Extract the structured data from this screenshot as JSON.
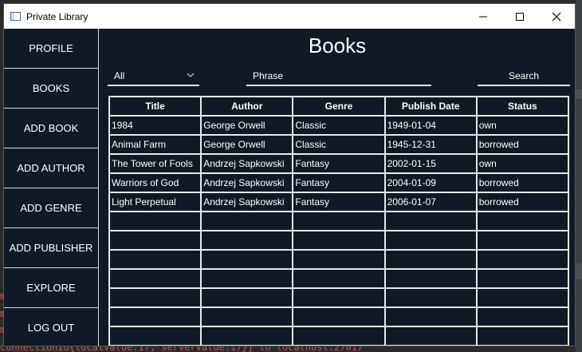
{
  "window": {
    "title": "Private Library"
  },
  "background": {
    "console_line": "connectionId{localValue:17, serverValue:17}] to localhost:27017",
    "console_marks": [
      "m",
      "m",
      "m"
    ]
  },
  "sidebar": {
    "items": [
      {
        "label": "PROFILE"
      },
      {
        "label": "BOOKS"
      },
      {
        "label": "ADD BOOK"
      },
      {
        "label": "ADD AUTHOR"
      },
      {
        "label": "ADD GENRE"
      },
      {
        "label": "ADD PUBLISHER"
      },
      {
        "label": "EXPLORE"
      },
      {
        "label": "LOG OUT"
      }
    ]
  },
  "main": {
    "title": "Books",
    "filter": {
      "selected": "All"
    },
    "search": {
      "placeholder": "Phrase",
      "button_label": "Search"
    },
    "table": {
      "columns": [
        "Title",
        "Author",
        "Genre",
        "Publish Date",
        "Status"
      ],
      "rows": [
        [
          "1984",
          "George Orwell",
          "Classic",
          "1949-01-04",
          "own"
        ],
        [
          "Animal Farm",
          "George Orwell",
          "Classic",
          "1945-12-31",
          "borrowed"
        ],
        [
          "The Tower of Fools",
          "Andrzej Sapkowski",
          "Fantasy",
          "2002-01-15",
          "own"
        ],
        [
          "Warriors of God",
          "Andrzej Sapkowski",
          "Fantasy",
          "2004-01-09",
          "borrowed"
        ],
        [
          "Light Perpetual",
          "Andrzej Sapkowski",
          "Fantasy",
          "2006-01-07",
          "borrowed"
        ],
        [
          "",
          "",
          "",
          "",
          ""
        ],
        [
          "",
          "",
          "",
          "",
          ""
        ],
        [
          "",
          "",
          "",
          "",
          ""
        ],
        [
          "",
          "",
          "",
          "",
          ""
        ],
        [
          "",
          "",
          "",
          "",
          ""
        ],
        [
          "",
          "",
          "",
          "",
          ""
        ],
        [
          "",
          "",
          "",
          "",
          ""
        ]
      ]
    }
  },
  "colors": {
    "window_bg": "#0f1a26",
    "text": "#ffffff",
    "grid": "#e8e8e8"
  }
}
